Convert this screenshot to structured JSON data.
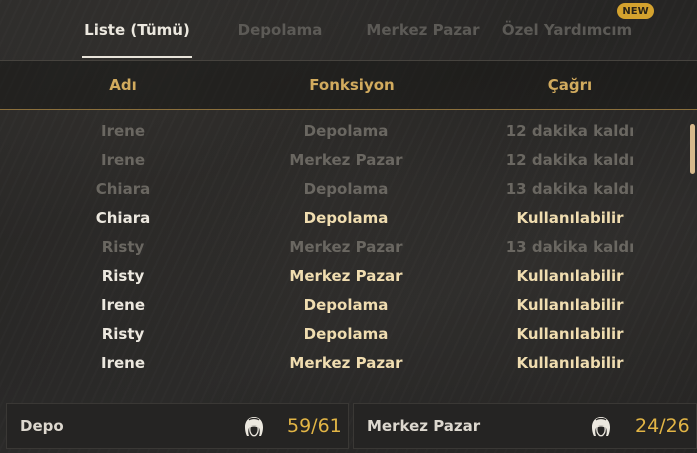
{
  "tabs": [
    {
      "label": "Liste (Tümü)",
      "active": true
    },
    {
      "label": "Depolama",
      "active": false
    },
    {
      "label": "Merkez Pazar",
      "active": false
    },
    {
      "label": "Özel Yardımcım",
      "active": false,
      "badge": "NEW"
    }
  ],
  "columns": {
    "name": "Adı",
    "function": "Fonksiyon",
    "call": "Çağrı"
  },
  "rows": [
    {
      "name": "Irene",
      "function": "Depolama",
      "call": "12 dakika kaldı",
      "available": false
    },
    {
      "name": "Irene",
      "function": "Merkez Pazar",
      "call": "12 dakika kaldı",
      "available": false
    },
    {
      "name": "Chiara",
      "function": "Depolama",
      "call": "13 dakika kaldı",
      "available": false
    },
    {
      "name": "Chiara",
      "function": "Depolama",
      "call": "Kullanılabilir",
      "available": true
    },
    {
      "name": "Risty",
      "function": "Merkez Pazar",
      "call": "13 dakika kaldı",
      "available": false
    },
    {
      "name": "Risty",
      "function": "Merkez Pazar",
      "call": "Kullanılabilir",
      "available": true
    },
    {
      "name": "Irene",
      "function": "Depolama",
      "call": "Kullanılabilir",
      "available": true
    },
    {
      "name": "Risty",
      "function": "Depolama",
      "call": "Kullanılabilir",
      "available": true
    },
    {
      "name": "Irene",
      "function": "Merkez Pazar",
      "call": "Kullanılabilir",
      "available": true
    }
  ],
  "panels": {
    "depo": {
      "label": "Depo",
      "count": "59/61",
      "icon": "maid-head-icon"
    },
    "pazar": {
      "label": "Merkez Pazar",
      "count": "24/26",
      "icon": "maid-head-icon"
    }
  },
  "colors": {
    "accent_gold": "#d2ab5e",
    "count_gold": "#e2b545",
    "badge": "#d4a22e",
    "scroll_thumb": "#d7b98c"
  }
}
